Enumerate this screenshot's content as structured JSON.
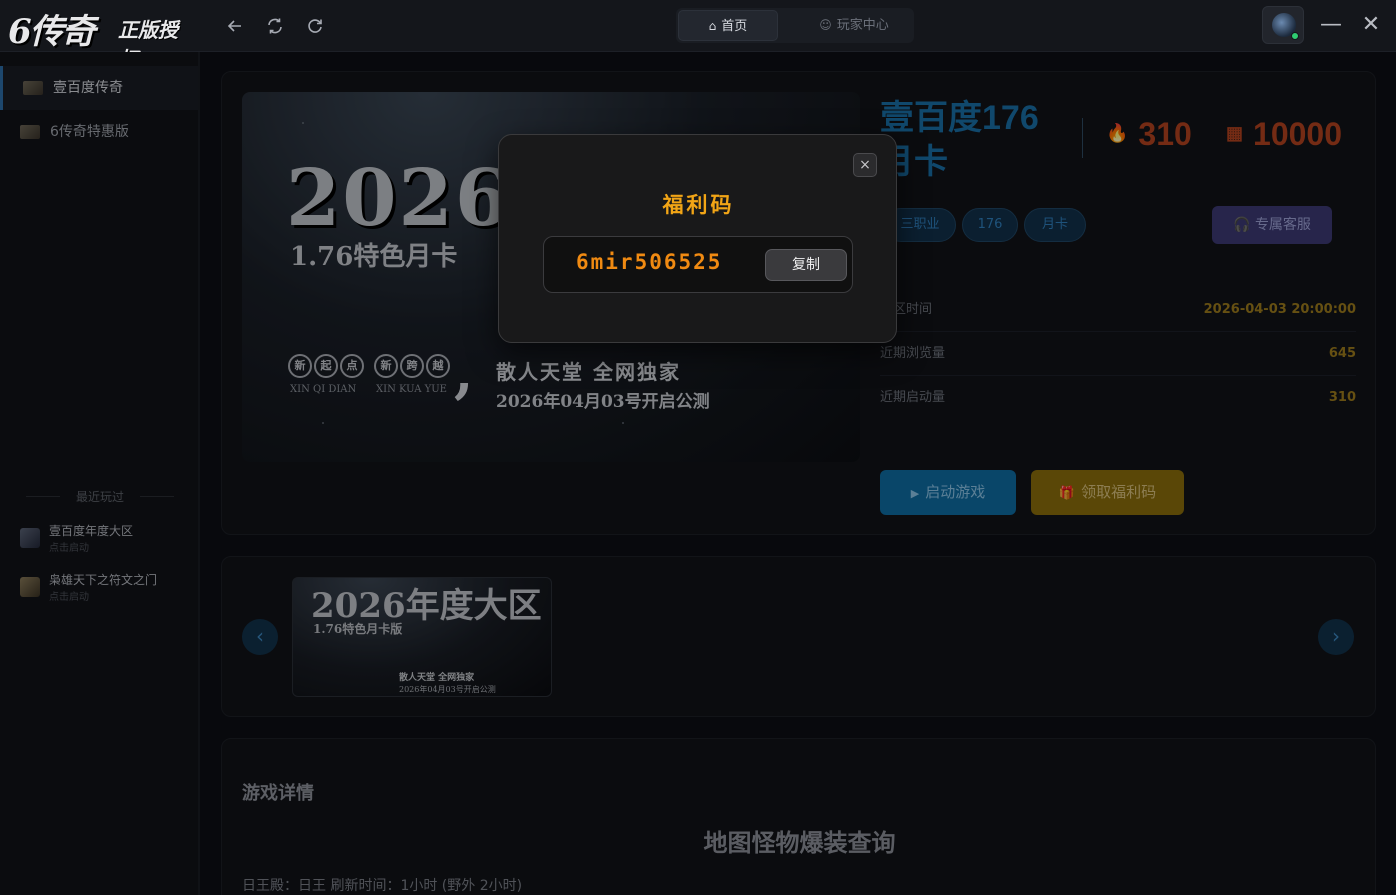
{
  "app": {
    "logo_main": "6传奇",
    "logo_sub": "正版授权"
  },
  "nav": {
    "back_icon": "arrow-left-icon",
    "refresh_icon": "refresh-icon",
    "reload_icon": "reload-icon"
  },
  "tabs": [
    {
      "label": "首页",
      "icon": "home-icon",
      "active": true
    },
    {
      "label": "玩家中心",
      "icon": "user-icon",
      "active": false
    }
  ],
  "window": {
    "minimize": "—",
    "close": "✕"
  },
  "sidebar": {
    "items": [
      {
        "label": "壹百度传奇",
        "active": true
      },
      {
        "label": "6传奇特惠版",
        "active": false
      }
    ],
    "recent_title": "最近玩过",
    "recent": [
      {
        "name": "壹百度年度大区",
        "hint": "点击启动"
      },
      {
        "name": "枭雄天下之符文之门",
        "hint": "点击启动"
      }
    ]
  },
  "banner": {
    "big_text": "2026年",
    "sub_text": "1.76特色月卡",
    "seals": [
      "新",
      "起",
      "点",
      "新",
      "跨",
      "越"
    ],
    "pinyin_1": "XIN QI DIAN",
    "pinyin_2": "XIN KUA YUE",
    "slogan": "散人天堂  全网独家",
    "date_line": "2026年04月03号开启公测"
  },
  "game": {
    "title": "壹百度176月卡",
    "launches_stat": "310",
    "capacity_stat": "10000",
    "tags": [
      "三职业",
      "176",
      "月卡"
    ],
    "service_button": "专属客服",
    "info": [
      {
        "key": "开区时间",
        "value": "2026-04-03 20:00:00"
      },
      {
        "key": "近期浏览量",
        "value": "645"
      },
      {
        "key": "近期启动量",
        "value": "310"
      }
    ],
    "start_button": "启动游戏",
    "gift_button": "领取福利码"
  },
  "carousel": {
    "thumb_title": "2026年度大区",
    "thumb_sub": "1.76特色月卡版",
    "thumb_slogan": "散人天堂  全网独家",
    "thumb_date": "2026年04月03号开启公测",
    "prev": "‹",
    "next": "›"
  },
  "details": {
    "section_title": "游戏详情",
    "heading": "地图怪物爆装查询",
    "first_line": "日王殿：日王  刷新时间：1小时 (野外 2小时)"
  },
  "modal": {
    "title": "福利码",
    "code": "6mir506525",
    "copy_button": "复制",
    "close": "×"
  },
  "colors": {
    "accent_blue": "#1a6fa6",
    "stat_red": "#b3421f",
    "value_gold": "#9d7c1d",
    "code_orange": "#f08a12",
    "title_orange": "#f2a516"
  }
}
